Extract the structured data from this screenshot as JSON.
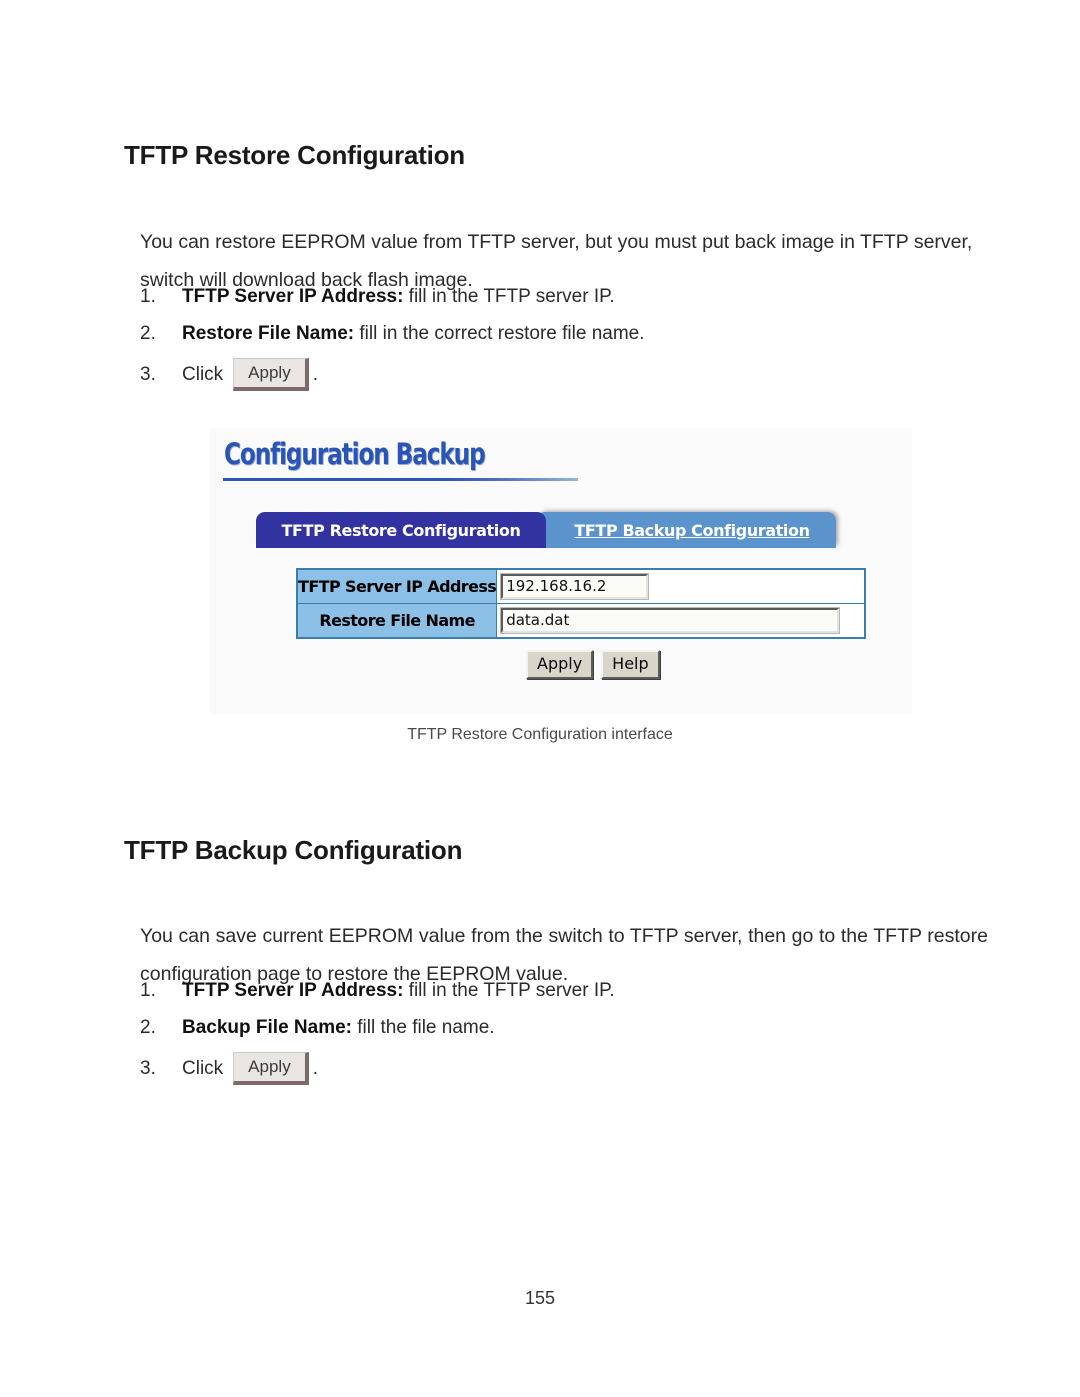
{
  "page": {
    "number": "155"
  },
  "sections": [
    {
      "heading": "TFTP Restore Configuration",
      "paragraph": "You can restore EEPROM value from TFTP server, but you must put back image in TFTP server, switch will download back flash image.",
      "steps": [
        {
          "num": "1.",
          "bold": "TFTP Server IP Address:",
          "rest": " fill in the TFTP server IP."
        },
        {
          "num": "2.",
          "bold": "Restore File Name:",
          "rest": " fill in the correct restore file name."
        },
        {
          "num": "3.",
          "click_label": "Click",
          "button": "Apply",
          "period": "."
        }
      ]
    },
    {
      "heading": "TFTP Backup Configuration",
      "paragraph": "You can save current EEPROM value from the switch to TFTP server, then go to the TFTP restore configuration page to restore the EEPROM value.",
      "steps": [
        {
          "num": "1.",
          "bold": "TFTP Server IP Address:",
          "rest": " fill in the TFTP server IP."
        },
        {
          "num": "2.",
          "bold": "Backup File Name:",
          "rest": " fill the file name."
        },
        {
          "num": "3.",
          "click_label": "Click",
          "button": "Apply",
          "period": "."
        }
      ]
    }
  ],
  "screenshot": {
    "title": "Configuration Backup",
    "tabs": [
      {
        "label": "TFTP Restore Configuration",
        "active": true
      },
      {
        "label": "TFTP Backup Configuration",
        "active": false
      }
    ],
    "form": {
      "rows": [
        {
          "label": "TFTP Server IP Address",
          "value": "192.168.16.2"
        },
        {
          "label": "Restore File Name",
          "value": "data.dat"
        }
      ]
    },
    "buttons": {
      "apply": "Apply",
      "help": "Help"
    },
    "caption": "TFTP Restore Configuration interface",
    "colors": {
      "title_blue": "#2b55b4",
      "tab_active": "#3232a0",
      "tab_inactive": "#5b93cc",
      "label_cell": "#8cc0e6",
      "table_border": "#3a7fa8",
      "panel_bg": "#fafafa"
    }
  }
}
